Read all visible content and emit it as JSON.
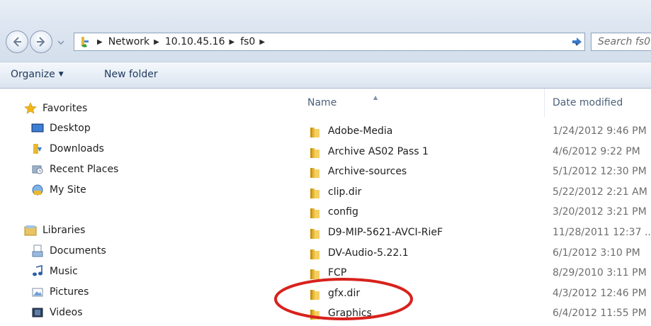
{
  "address": {
    "crumbs": [
      "Network",
      "10.10.45.16",
      "fs0"
    ],
    "search_placeholder": "Search fs0"
  },
  "toolbar": {
    "organize_label": "Organize",
    "new_folder_label": "New folder"
  },
  "nav": {
    "favorites": {
      "label": "Favorites",
      "items": [
        {
          "label": "Desktop",
          "icon": "desktop-icon"
        },
        {
          "label": "Downloads",
          "icon": "downloads-icon"
        },
        {
          "label": "Recent Places",
          "icon": "recent-places-icon"
        },
        {
          "label": "My Site",
          "icon": "my-site-icon"
        }
      ]
    },
    "libraries": {
      "label": "Libraries",
      "items": [
        {
          "label": "Documents",
          "icon": "documents-icon"
        },
        {
          "label": "Music",
          "icon": "music-icon"
        },
        {
          "label": "Pictures",
          "icon": "pictures-icon"
        },
        {
          "label": "Videos",
          "icon": "videos-icon"
        }
      ]
    }
  },
  "files": {
    "columns": {
      "name": "Name",
      "date": "Date modified"
    },
    "rows": [
      {
        "name": "Adobe-Media",
        "date": "1/24/2012 9:46 PM"
      },
      {
        "name": "Archive AS02 Pass 1",
        "date": "4/6/2012 9:22 PM"
      },
      {
        "name": "Archive-sources",
        "date": "5/1/2012 12:30 PM"
      },
      {
        "name": "clip.dir",
        "date": "5/22/2012 2:21 AM"
      },
      {
        "name": "config",
        "date": "3/20/2012 3:21 PM"
      },
      {
        "name": "D9-MIP-5621-AVCI-RieF",
        "date": "11/28/2011 12:37 ..."
      },
      {
        "name": "DV-Audio-5.22.1",
        "date": "6/1/2012 3:10 PM"
      },
      {
        "name": "FCP",
        "date": "8/29/2010 3:11 PM"
      },
      {
        "name": "gfx.dir",
        "date": "4/3/2012 12:46 PM"
      },
      {
        "name": "Graphics",
        "date": "6/4/2012 11:55 PM"
      }
    ]
  },
  "annotation": {
    "highlighted_item": "gfx.dir",
    "color": "#d8221d"
  },
  "colors": {
    "folder": "#e8b830",
    "toolbar_text": "#1e395b",
    "header_text": "#4c607a"
  }
}
